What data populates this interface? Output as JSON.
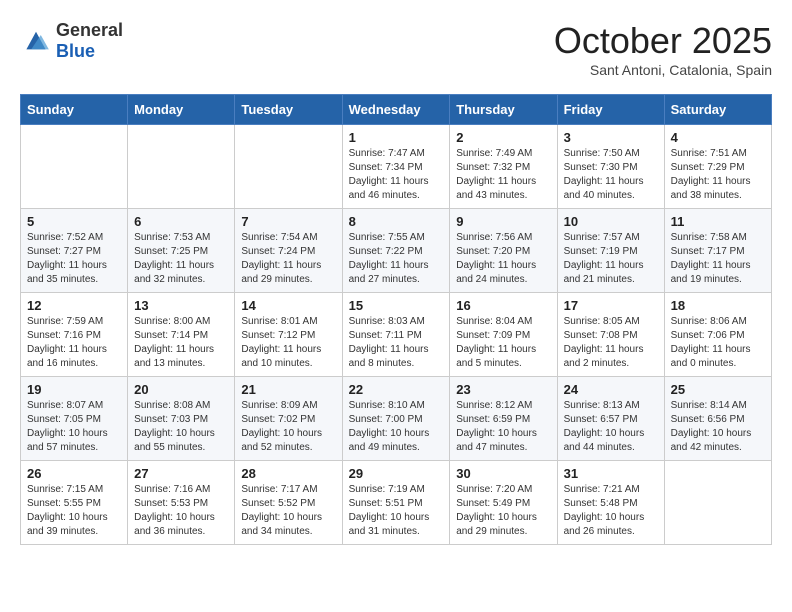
{
  "header": {
    "logo": {
      "general": "General",
      "blue": "Blue"
    },
    "title": "October 2025",
    "location": "Sant Antoni, Catalonia, Spain"
  },
  "weekdays": [
    "Sunday",
    "Monday",
    "Tuesday",
    "Wednesday",
    "Thursday",
    "Friday",
    "Saturday"
  ],
  "weeks": [
    [
      {
        "day": "",
        "sunrise": "",
        "sunset": "",
        "daylight": ""
      },
      {
        "day": "",
        "sunrise": "",
        "sunset": "",
        "daylight": ""
      },
      {
        "day": "",
        "sunrise": "",
        "sunset": "",
        "daylight": ""
      },
      {
        "day": "1",
        "sunrise": "Sunrise: 7:47 AM",
        "sunset": "Sunset: 7:34 PM",
        "daylight": "Daylight: 11 hours and 46 minutes."
      },
      {
        "day": "2",
        "sunrise": "Sunrise: 7:49 AM",
        "sunset": "Sunset: 7:32 PM",
        "daylight": "Daylight: 11 hours and 43 minutes."
      },
      {
        "day": "3",
        "sunrise": "Sunrise: 7:50 AM",
        "sunset": "Sunset: 7:30 PM",
        "daylight": "Daylight: 11 hours and 40 minutes."
      },
      {
        "day": "4",
        "sunrise": "Sunrise: 7:51 AM",
        "sunset": "Sunset: 7:29 PM",
        "daylight": "Daylight: 11 hours and 38 minutes."
      }
    ],
    [
      {
        "day": "5",
        "sunrise": "Sunrise: 7:52 AM",
        "sunset": "Sunset: 7:27 PM",
        "daylight": "Daylight: 11 hours and 35 minutes."
      },
      {
        "day": "6",
        "sunrise": "Sunrise: 7:53 AM",
        "sunset": "Sunset: 7:25 PM",
        "daylight": "Daylight: 11 hours and 32 minutes."
      },
      {
        "day": "7",
        "sunrise": "Sunrise: 7:54 AM",
        "sunset": "Sunset: 7:24 PM",
        "daylight": "Daylight: 11 hours and 29 minutes."
      },
      {
        "day": "8",
        "sunrise": "Sunrise: 7:55 AM",
        "sunset": "Sunset: 7:22 PM",
        "daylight": "Daylight: 11 hours and 27 minutes."
      },
      {
        "day": "9",
        "sunrise": "Sunrise: 7:56 AM",
        "sunset": "Sunset: 7:20 PM",
        "daylight": "Daylight: 11 hours and 24 minutes."
      },
      {
        "day": "10",
        "sunrise": "Sunrise: 7:57 AM",
        "sunset": "Sunset: 7:19 PM",
        "daylight": "Daylight: 11 hours and 21 minutes."
      },
      {
        "day": "11",
        "sunrise": "Sunrise: 7:58 AM",
        "sunset": "Sunset: 7:17 PM",
        "daylight": "Daylight: 11 hours and 19 minutes."
      }
    ],
    [
      {
        "day": "12",
        "sunrise": "Sunrise: 7:59 AM",
        "sunset": "Sunset: 7:16 PM",
        "daylight": "Daylight: 11 hours and 16 minutes."
      },
      {
        "day": "13",
        "sunrise": "Sunrise: 8:00 AM",
        "sunset": "Sunset: 7:14 PM",
        "daylight": "Daylight: 11 hours and 13 minutes."
      },
      {
        "day": "14",
        "sunrise": "Sunrise: 8:01 AM",
        "sunset": "Sunset: 7:12 PM",
        "daylight": "Daylight: 11 hours and 10 minutes."
      },
      {
        "day": "15",
        "sunrise": "Sunrise: 8:03 AM",
        "sunset": "Sunset: 7:11 PM",
        "daylight": "Daylight: 11 hours and 8 minutes."
      },
      {
        "day": "16",
        "sunrise": "Sunrise: 8:04 AM",
        "sunset": "Sunset: 7:09 PM",
        "daylight": "Daylight: 11 hours and 5 minutes."
      },
      {
        "day": "17",
        "sunrise": "Sunrise: 8:05 AM",
        "sunset": "Sunset: 7:08 PM",
        "daylight": "Daylight: 11 hours and 2 minutes."
      },
      {
        "day": "18",
        "sunrise": "Sunrise: 8:06 AM",
        "sunset": "Sunset: 7:06 PM",
        "daylight": "Daylight: 11 hours and 0 minutes."
      }
    ],
    [
      {
        "day": "19",
        "sunrise": "Sunrise: 8:07 AM",
        "sunset": "Sunset: 7:05 PM",
        "daylight": "Daylight: 10 hours and 57 minutes."
      },
      {
        "day": "20",
        "sunrise": "Sunrise: 8:08 AM",
        "sunset": "Sunset: 7:03 PM",
        "daylight": "Daylight: 10 hours and 55 minutes."
      },
      {
        "day": "21",
        "sunrise": "Sunrise: 8:09 AM",
        "sunset": "Sunset: 7:02 PM",
        "daylight": "Daylight: 10 hours and 52 minutes."
      },
      {
        "day": "22",
        "sunrise": "Sunrise: 8:10 AM",
        "sunset": "Sunset: 7:00 PM",
        "daylight": "Daylight: 10 hours and 49 minutes."
      },
      {
        "day": "23",
        "sunrise": "Sunrise: 8:12 AM",
        "sunset": "Sunset: 6:59 PM",
        "daylight": "Daylight: 10 hours and 47 minutes."
      },
      {
        "day": "24",
        "sunrise": "Sunrise: 8:13 AM",
        "sunset": "Sunset: 6:57 PM",
        "daylight": "Daylight: 10 hours and 44 minutes."
      },
      {
        "day": "25",
        "sunrise": "Sunrise: 8:14 AM",
        "sunset": "Sunset: 6:56 PM",
        "daylight": "Daylight: 10 hours and 42 minutes."
      }
    ],
    [
      {
        "day": "26",
        "sunrise": "Sunrise: 7:15 AM",
        "sunset": "Sunset: 5:55 PM",
        "daylight": "Daylight: 10 hours and 39 minutes."
      },
      {
        "day": "27",
        "sunrise": "Sunrise: 7:16 AM",
        "sunset": "Sunset: 5:53 PM",
        "daylight": "Daylight: 10 hours and 36 minutes."
      },
      {
        "day": "28",
        "sunrise": "Sunrise: 7:17 AM",
        "sunset": "Sunset: 5:52 PM",
        "daylight": "Daylight: 10 hours and 34 minutes."
      },
      {
        "day": "29",
        "sunrise": "Sunrise: 7:19 AM",
        "sunset": "Sunset: 5:51 PM",
        "daylight": "Daylight: 10 hours and 31 minutes."
      },
      {
        "day": "30",
        "sunrise": "Sunrise: 7:20 AM",
        "sunset": "Sunset: 5:49 PM",
        "daylight": "Daylight: 10 hours and 29 minutes."
      },
      {
        "day": "31",
        "sunrise": "Sunrise: 7:21 AM",
        "sunset": "Sunset: 5:48 PM",
        "daylight": "Daylight: 10 hours and 26 minutes."
      },
      {
        "day": "",
        "sunrise": "",
        "sunset": "",
        "daylight": ""
      }
    ]
  ]
}
